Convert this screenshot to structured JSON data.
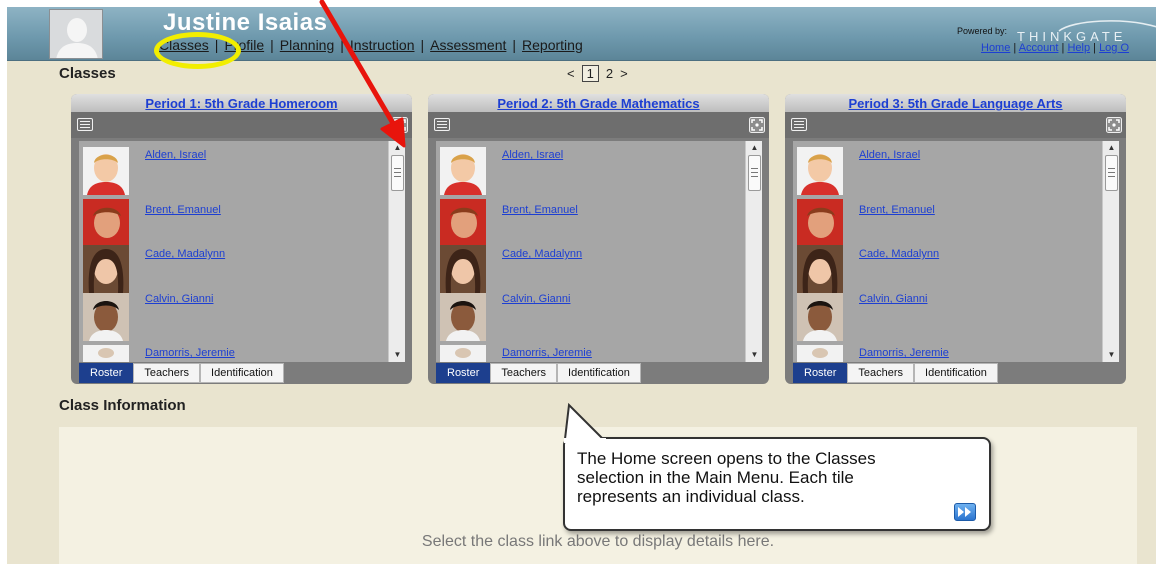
{
  "header": {
    "user_name": "Justine Isaias",
    "nav": [
      "Classes",
      "Profile",
      "Planning",
      "Instruction",
      "Assessment",
      "Reporting"
    ],
    "powered_by": "Powered by:",
    "brand": "THINKGATE",
    "util_links": [
      "Home",
      "Account",
      "Help",
      "Log O"
    ]
  },
  "classes": {
    "heading": "Classes",
    "pager": {
      "prev": "<",
      "current": "1",
      "next_page": "2",
      "next": ">"
    }
  },
  "tiles": [
    {
      "title": "Period 1: 5th Grade Homeroom",
      "students": [
        "Alden, Israel",
        "Brent, Emanuel",
        "Cade, Madalynn",
        "Calvin, Gianni",
        "Damorris, Jeremie"
      ],
      "tabs": [
        "Roster",
        "Teachers",
        "Identification"
      ]
    },
    {
      "title": "Period 2: 5th Grade Mathematics",
      "students": [
        "Alden, Israel",
        "Brent, Emanuel",
        "Cade, Madalynn",
        "Calvin, Gianni",
        "Damorris, Jeremie"
      ],
      "tabs": [
        "Roster",
        "Teachers",
        "Identification"
      ]
    },
    {
      "title": "Period 3: 5th Grade Language Arts",
      "students": [
        "Alden, Israel",
        "Brent, Emanuel",
        "Cade, Madalynn",
        "Calvin, Gianni",
        "Damorris, Jeremie"
      ],
      "tabs": [
        "Roster",
        "Teachers",
        "Identification"
      ]
    }
  ],
  "class_info": {
    "heading": "Class Information",
    "placeholder": "Select the class link above to display details here."
  },
  "callout": {
    "text": "The Home screen opens to the Classes selection in the Main Menu.  Each tile represents an individual class."
  },
  "icons": {
    "tile_menu": "menu-icon",
    "tile_expand": "expand-icon",
    "callout_next": "fast-forward-icon",
    "avatar": "user-silhouette-icon"
  },
  "colors": {
    "header": "#6f9aae",
    "page_background": "#e9e4cf",
    "tile_background": "#7c7c7c",
    "link": "#1d3fd2",
    "active_tab": "#1d3f8e",
    "annotation_ellipse": "#f2ee00",
    "annotation_arrow": "#e8140c"
  }
}
